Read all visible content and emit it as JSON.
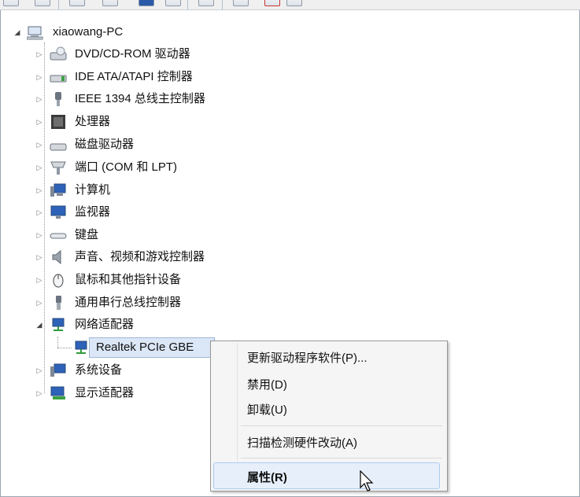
{
  "computer": {
    "name": "xiaowang-PC"
  },
  "tree": {
    "items": [
      "DVD/CD-ROM 驱动器",
      "IDE ATA/ATAPI 控制器",
      "IEEE 1394 总线主控制器",
      "处理器",
      "磁盘驱动器",
      "端口 (COM 和 LPT)",
      "计算机",
      "监视器",
      "键盘",
      "声音、视频和游戏控制器",
      "鼠标和其他指针设备",
      "通用串行总线控制器",
      "网络适配器",
      "系统设备",
      "显示适配器"
    ],
    "network_child": "Realtek PCIe GBE"
  },
  "context_menu": {
    "update": "更新驱动程序软件(P)...",
    "disable": "禁用(D)",
    "uninstall": "卸载(U)",
    "scan": "扫描检测硬件改动(A)",
    "properties": "属性(R)"
  },
  "icons": [
    "computer-icon",
    "dvd-drive-icon",
    "ide-controller-icon",
    "firewire-icon",
    "cpu-icon",
    "disk-drive-icon",
    "port-icon",
    "computer-node-icon",
    "monitor-icon",
    "keyboard-icon",
    "speaker-icon",
    "mouse-icon",
    "usb-icon",
    "network-adapter-icon",
    "system-device-icon",
    "display-adapter-icon",
    "mouse-cursor-icon"
  ],
  "colors": {
    "selection": "#dbe7f6",
    "menu_highlight": "#e6effa",
    "menu_bg": "#f5f5f5"
  }
}
